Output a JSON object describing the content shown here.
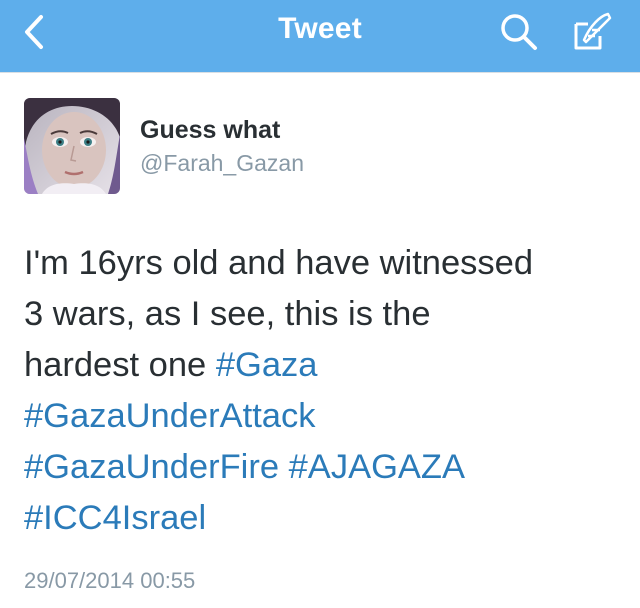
{
  "navbar": {
    "title": "Tweet",
    "back_icon": "chevron-left-icon",
    "search_icon": "search-icon",
    "compose_icon": "compose-icon",
    "background_color": "#5eaeeb"
  },
  "tweet": {
    "author": {
      "name": "Guess what",
      "handle": "@Farah_Gazan",
      "avatar": "avatar-photo"
    },
    "text_lines": [
      [
        {
          "t": "I'm 16yrs old and have witnessed",
          "h": false
        }
      ],
      [
        {
          "t": "3 wars, as I see, this is the",
          "h": false
        }
      ],
      [
        {
          "t": "hardest one ",
          "h": false
        },
        {
          "t": "#Gaza",
          "h": true
        }
      ],
      [
        {
          "t": "#GazaUnderAttack",
          "h": true
        }
      ],
      [
        {
          "t": "#GazaUnderFire",
          "h": true
        },
        {
          "t": " ",
          "h": false
        },
        {
          "t": "#AJAGAZA",
          "h": true
        }
      ],
      [
        {
          "t": "#ICC4Israel",
          "h": true
        }
      ]
    ],
    "timestamp": "29/07/2014 00:55",
    "hashtag_color": "#2b7bb9",
    "text_color": "#292f33"
  }
}
